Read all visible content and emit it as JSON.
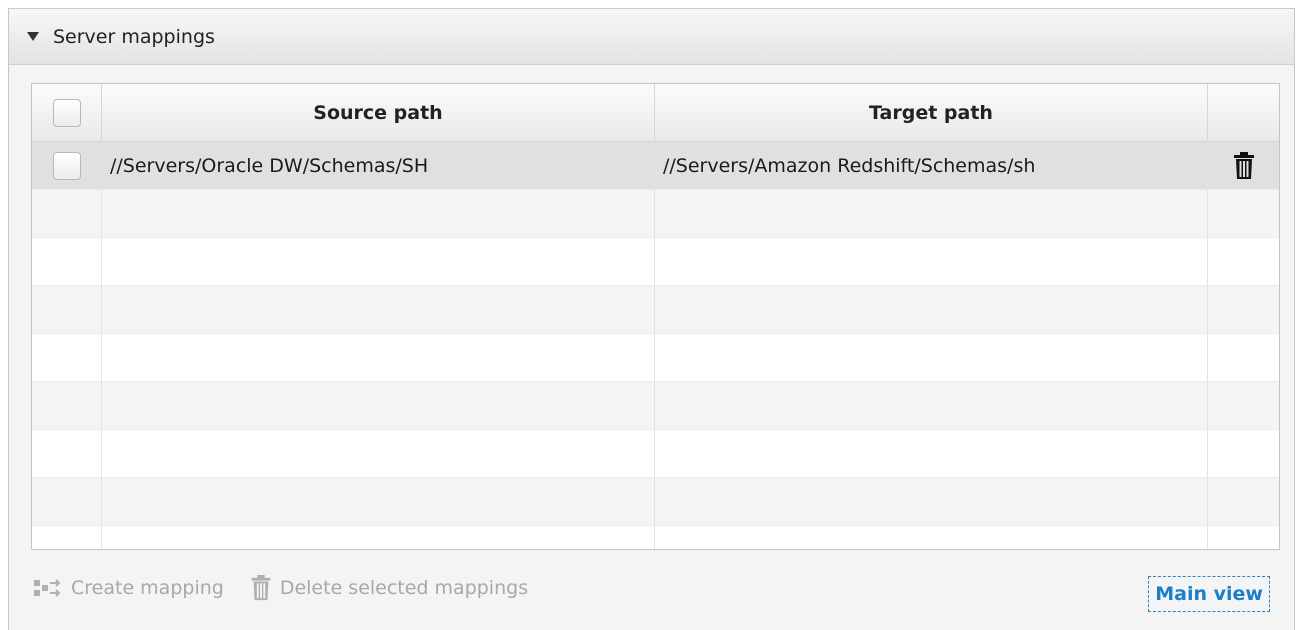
{
  "panel": {
    "title": "Server mappings"
  },
  "table": {
    "columns": [
      "Source path",
      "Target path"
    ],
    "rows": [
      {
        "source": "//Servers/Oracle DW/Schemas/SH",
        "target": "//Servers/Amazon Redshift/Schemas/sh",
        "action_icon": "trash-icon"
      }
    ],
    "empty_rows": 8
  },
  "footer": {
    "create_label": "Create mapping",
    "create_icon": "mapping-icon",
    "delete_label": "Delete selected mappings",
    "delete_icon": "trash-icon",
    "main_view_label": "Main view"
  },
  "colors": {
    "link": "#1a7fc9",
    "disabled_text": "#a8a8a8",
    "selected_row": "#e0e0e0"
  }
}
